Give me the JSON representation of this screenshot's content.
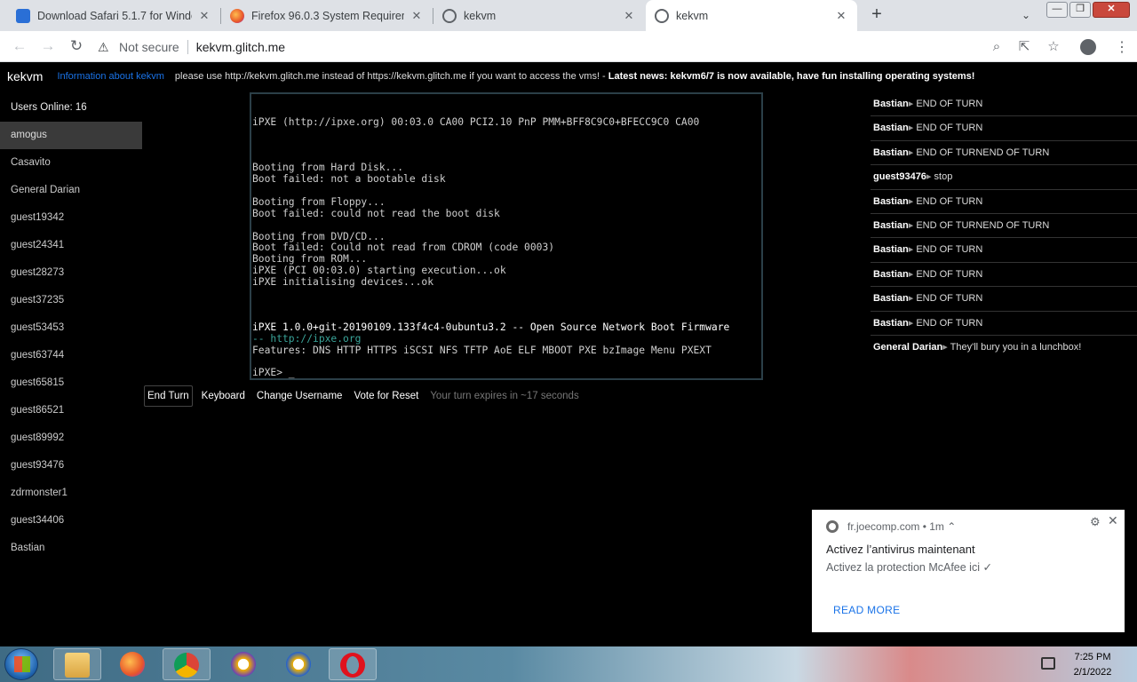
{
  "browser": {
    "tabs": [
      {
        "title": "Download Safari 5.1.7 for Windo",
        "active": false
      },
      {
        "title": "Firefox 96.0.3 System Requireme",
        "active": false
      },
      {
        "title": "kekvm",
        "active": false
      },
      {
        "title": "kekvm",
        "active": true
      }
    ],
    "new_tab": "+",
    "security": "Not secure",
    "url": "kekvm.glitch.me"
  },
  "page": {
    "brand": "kekvm",
    "info_link": "Information about kekvm",
    "notice_prefix": "please use http://kekvm.glitch.me instead of https://kekvm.glitch.me if you want to access the vms! - ",
    "notice_news": "Latest news: kekvm6/7 is now available, have fun installing operating systems!",
    "users_online": "Users Online: 16",
    "users": [
      "amogus",
      "Casavito",
      "General Darian",
      "guest19342",
      "guest24341",
      "guest28273",
      "guest37235",
      "guest53453",
      "guest63744",
      "guest65815",
      "guest86521",
      "guest89992",
      "guest93476",
      "zdrmonster1",
      "guest34406",
      "Bastian"
    ],
    "selected_user": "amogus",
    "vm_console": [
      "iPXE (http://ipxe.org) 00:03.0 CA00 PCI2.10 PnP PMM+BFF8C9C0+BFECC9C0 CA00",
      "Booting from Hard Disk...",
      "Boot failed: not a bootable disk",
      "Booting from Floppy...",
      "Boot failed: could not read the boot disk",
      "Booting from DVD/CD...",
      "Boot failed: Could not read from CDROM (code 0003)",
      "Booting from ROM...",
      "iPXE (PCI 00:03.0) starting execution...ok",
      "iPXE initialising devices...ok",
      "iPXE 1.0.0+git-20190109.133f4c4-0ubuntu3.2 -- Open Source Network Boot Firmware",
      "-- ",
      "http://ipxe.org",
      "Features: DNS HTTP HTTPS iSCSI NFS TFTP AoE ELF MBOOT PXE bzImage Menu PXEXT",
      "iPXE> _"
    ],
    "controls": {
      "end_turn": "End Turn",
      "keyboard": "Keyboard",
      "change_username": "Change Username",
      "vote_reset": "Vote for Reset",
      "turn_info": "Your turn expires in ~17 seconds"
    },
    "chat": [
      {
        "user": "Bastian",
        "text": "END OF TURN"
      },
      {
        "user": "Bastian",
        "text": "END OF TURN"
      },
      {
        "user": "Bastian",
        "text": "END OF TURNEND OF TURN"
      },
      {
        "user": "guest93476",
        "text": "stop"
      },
      {
        "user": "Bastian",
        "text": "END OF TURN"
      },
      {
        "user": "Bastian",
        "text": "END OF TURNEND OF TURN"
      },
      {
        "user": "Bastian",
        "text": "END OF TURN"
      },
      {
        "user": "Bastian",
        "text": "END OF TURN"
      },
      {
        "user": "Bastian",
        "text": "END OF TURN"
      },
      {
        "user": "Bastian",
        "text": "END OF TURN"
      },
      {
        "user": "General Darian",
        "text": "They'll bury you in a lunchbox!"
      }
    ],
    "chat_separator": "▸ "
  },
  "notification": {
    "source": "fr.joecomp.com",
    "time": "• 1m ⌃",
    "title": "Activez l’antivirus maintenant",
    "body": "Activez la protection McAfee ici ✓",
    "action": "READ MORE"
  },
  "taskbar": {
    "time": "7:25 PM",
    "date": "2/1/2022"
  },
  "colors": {
    "page_bg": "#000000",
    "link": "#1a73e8",
    "console_teal": "#3aa59a"
  }
}
